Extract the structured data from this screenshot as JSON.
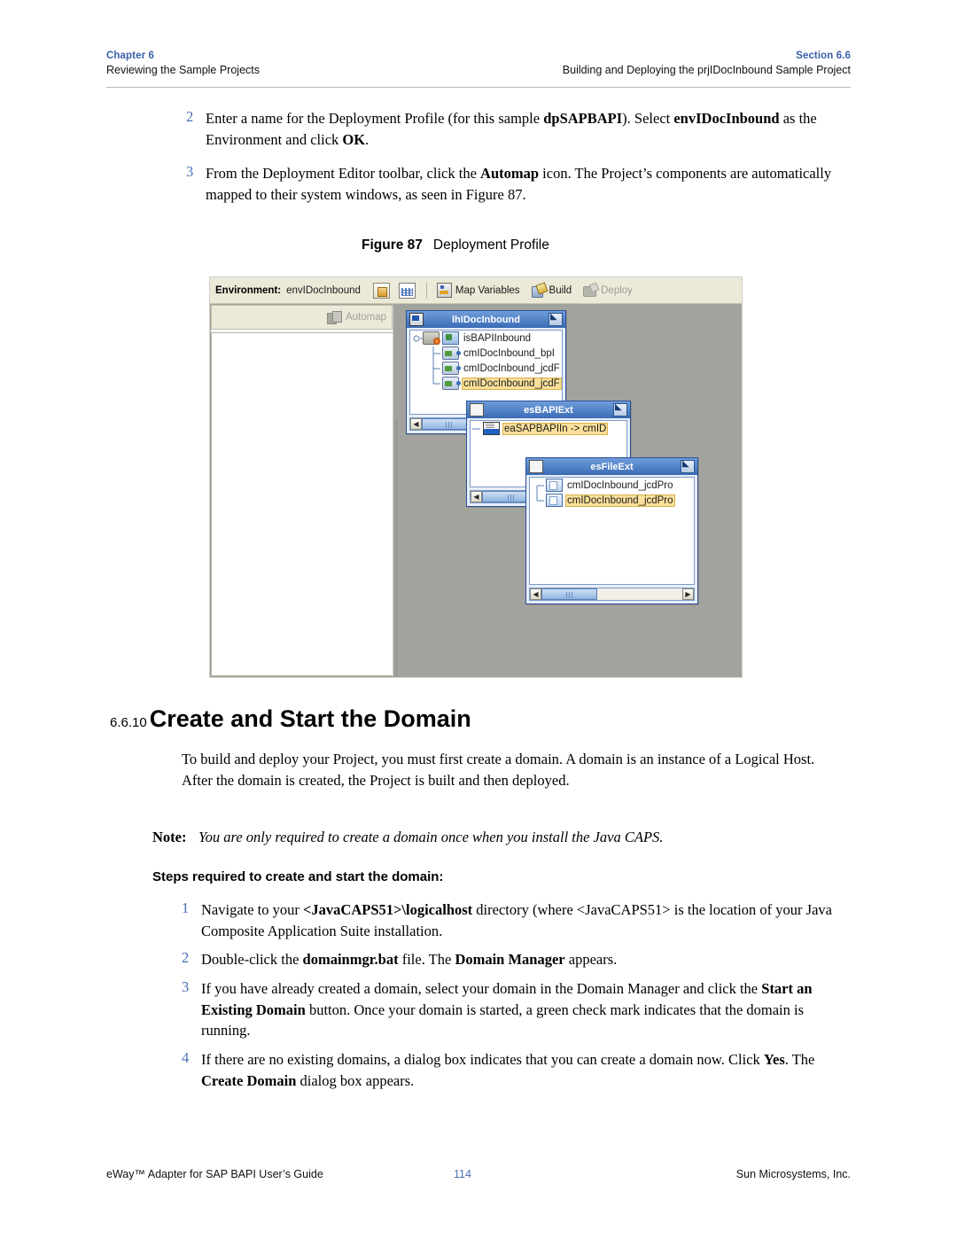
{
  "header": {
    "chapter": "Chapter 6",
    "chapter_sub": "Reviewing the Sample Projects",
    "section": "Section 6.6",
    "section_sub": "Building and Deploying the prjIDocInbound Sample Project"
  },
  "steps_top": [
    {
      "num": "2",
      "html": "Enter a name for the Deployment Profile (for this sample <b>dpSAPBAPI</b>). Select <b>envIDocInbound</b> as the Environment and click <b>OK</b>."
    },
    {
      "num": "3",
      "html": "From the Deployment Editor toolbar, click the <b>Automap</b> icon. The Project&#8217;s components are automatically mapped to their system windows, as seen in Figure 87."
    }
  ],
  "figure": {
    "label": "Figure 87",
    "title": "Deployment Profile"
  },
  "screenshot": {
    "toolbar": {
      "environment_label": "Environment:",
      "environment_value": "envIDocInbound",
      "icons": [
        "documents-icon",
        "grid-icon"
      ],
      "buttons": [
        {
          "label": "Map Variables",
          "icon": "map-variables-icon",
          "enabled": true
        },
        {
          "label": "Build",
          "icon": "build-icon",
          "enabled": true
        },
        {
          "label": "Deploy",
          "icon": "deploy-icon",
          "enabled": false
        }
      ]
    },
    "automap": {
      "label": "Automap",
      "icon": "automap-icon",
      "enabled": false
    },
    "windows": [
      {
        "title": "lhIDocInbound",
        "title_icon": "monitor-icon",
        "rows": [
          {
            "label": "isBAPIInbound",
            "icon": "service-icon",
            "selected": false,
            "indent": 0
          },
          {
            "label": "cmIDocInbound_bpI",
            "icon": "connection-icon",
            "selected": false,
            "indent": 1
          },
          {
            "label": "cmIDocInbound_jcdF",
            "icon": "connection-icon",
            "selected": false,
            "indent": 1
          },
          {
            "label": "cmIDocInbound_jcdF",
            "icon": "connection-icon",
            "selected": true,
            "indent": 1
          }
        ]
      },
      {
        "title": "esBAPIExt",
        "title_icon": "blank-icon",
        "rows": [
          {
            "label": "eaSAPBAPIIn -> cmID",
            "icon": "sap-icon",
            "selected": true,
            "indent": 0
          }
        ]
      },
      {
        "title": "esFileExt",
        "title_icon": "blank-icon",
        "rows": [
          {
            "label": "cmIDocInbound_jcdPro",
            "icon": "file-icon",
            "selected": false,
            "indent": 0
          },
          {
            "label": "cmIDocInbound_jcdPro",
            "icon": "file-icon",
            "selected": true,
            "indent": 0
          }
        ]
      }
    ]
  },
  "section": {
    "number": "6.6.10",
    "title": "Create and Start the Domain",
    "intro": "To build and deploy your Project, you must first create a domain. A domain is an instance of a Logical Host. After the domain is created, the Project is built and then deployed.",
    "note_label": "Note:",
    "note_text": "You are only required to create a domain once when you install the Java CAPS.",
    "steps_heading": "Steps required to create and start the domain:"
  },
  "steps_bottom": [
    {
      "num": "1",
      "html": "Navigate to your <b>&lt;JavaCAPS51&gt;\\logicalhost</b> directory (where &lt;JavaCAPS51&gt; is the location of your Java Composite Application Suite installation."
    },
    {
      "num": "2",
      "html": "Double-click the <b>domainmgr.bat</b> file. The <b>Domain Manager</b> appears."
    },
    {
      "num": "3",
      "html": "If you have already created a domain, select your domain in the Domain Manager and click the <b>Start an Existing Domain</b> button. Once your domain is started, a green check mark indicates that the domain is running."
    },
    {
      "num": "4",
      "html": "If there are no existing domains, a dialog box indicates that you can create a domain now. Click <b>Yes</b>. The <b>Create Domain</b> dialog box appears."
    }
  ],
  "footer": {
    "left": "eWay™ Adapter for SAP BAPI User’s Guide",
    "page": "114",
    "right": "Sun Microsystems, Inc."
  }
}
